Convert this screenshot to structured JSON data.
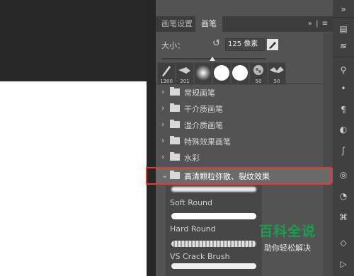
{
  "tabs": [
    {
      "label": "画笔设置"
    },
    {
      "label": "画笔"
    }
  ],
  "tab_controls": "» | ≡",
  "size": {
    "label": "大小：",
    "value": "125 像素"
  },
  "presets": [
    {
      "size": "1300"
    },
    {
      "size": "201"
    },
    {
      "size": ""
    },
    {
      "size": ""
    },
    {
      "size": ""
    },
    {
      "size": "50"
    },
    {
      "size": "50"
    }
  ],
  "folders": [
    {
      "label": "常规画笔"
    },
    {
      "label": "干介质画笔"
    },
    {
      "label": "湿介质画笔"
    },
    {
      "label": "特殊效果画笔"
    },
    {
      "label": "水彩"
    },
    {
      "label": "高清颗粒弥散、裂纹效果"
    }
  ],
  "brushes": [
    {
      "name": "Soft Round"
    },
    {
      "name": "Hard Round"
    },
    {
      "name": "VS Crack Brush"
    }
  ],
  "watermark": {
    "title": "百科全说",
    "subtitle": "助你轻松解决"
  },
  "colors": {
    "panel": "#535353",
    "highlight": "#e53935",
    "watermark": "#1a9f4b"
  }
}
